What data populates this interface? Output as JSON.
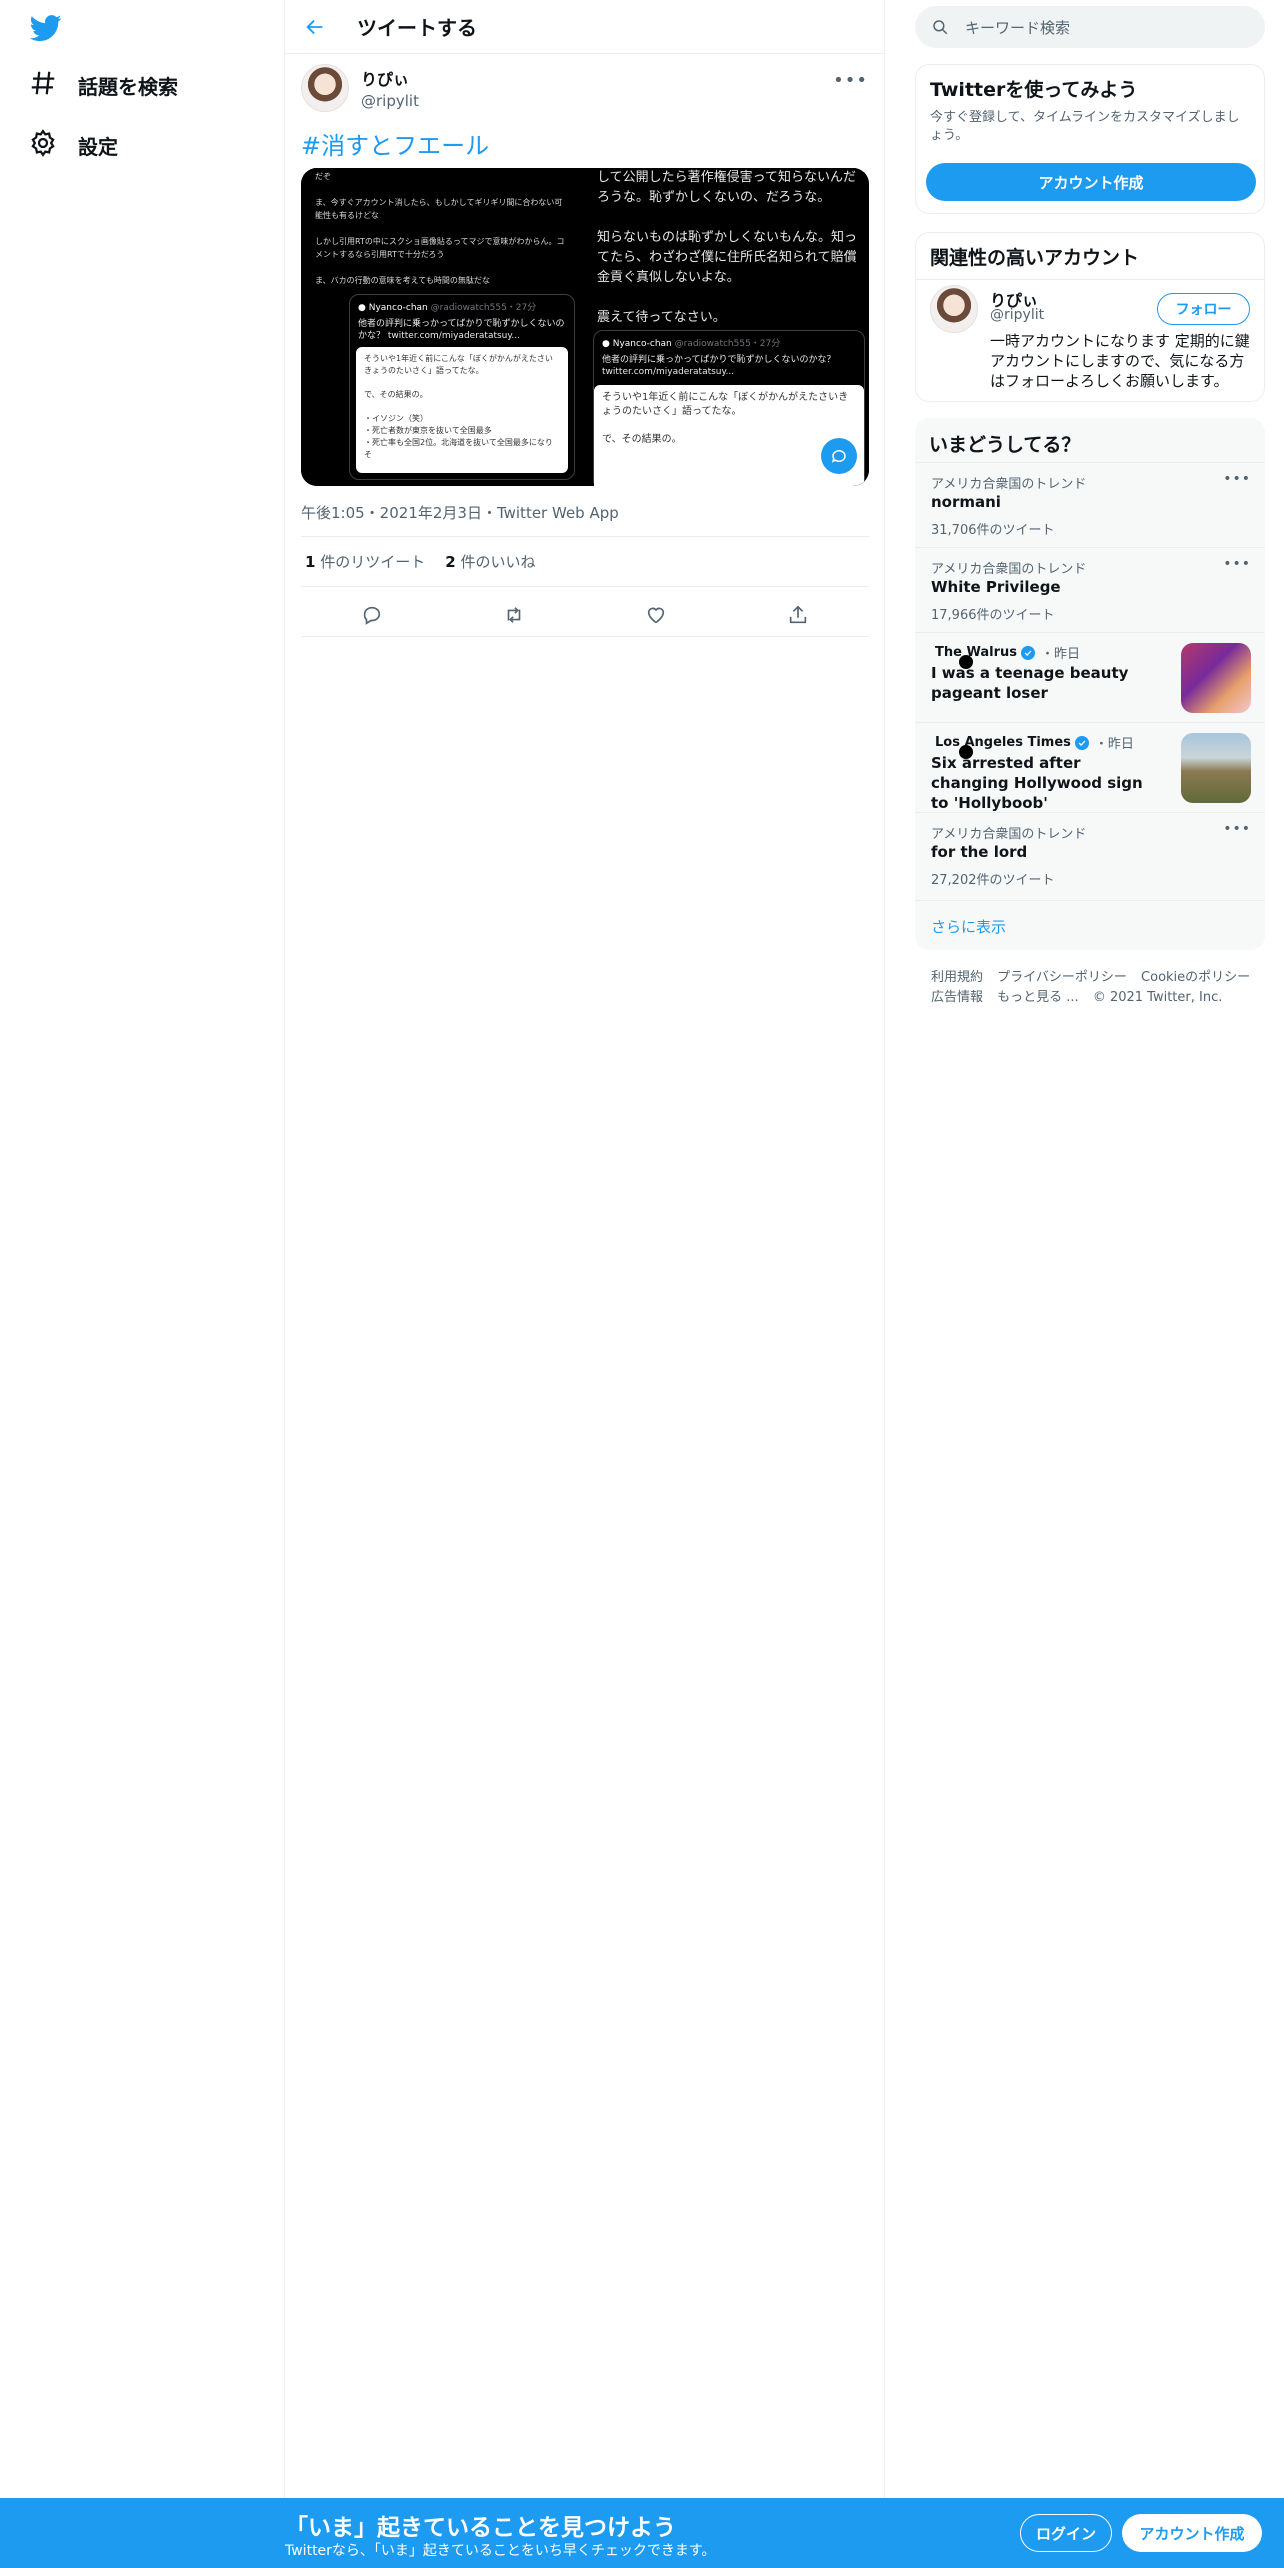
{
  "nav": {
    "explore_label": "話題を検索",
    "settings_label": "設定"
  },
  "header": {
    "title": "ツイートする"
  },
  "tweet": {
    "display_name": "りぴぃ",
    "handle": "@ripylit",
    "hashtag": "#消すとフエール",
    "timestamp": "午後1:05・2021年2月3日・Twitter Web App",
    "retweets_count": "1",
    "retweets_label": "件のリツイート",
    "likes_count": "2",
    "likes_label": "件のいいね",
    "media": {
      "left": {
        "top_text": "だぞ\n\nま、今すぐアカウント消したら、もしかしてギリギリ間に合わない可能性も有るけどな\n\nしかし引用RTの中にスクショ画像貼るってマジで意味がわからん。コメントするなら引用RTで十分だろう\n\nま、バカの行動の意味を考えても時間の無駄だな",
        "quote_name": "Nyanco-chan",
        "quote_handle": "@radiowatch555・27分",
        "quote_text": "他者の評判に乗っかってばかりで恥ずかしくないのかな？ twitter.com/miyaderatatsuy...",
        "inner_text": "そういや1年近く前にこんな「ぼくがかんがえたさいきょうのたいさく」語ってたな。\n\nで、その結果の。\n\n・イソジン（笑）\n・死亡者数が東京を抜いて全国最多\n・死亡率も全国2位。北海道を抜いて全国最多になりそ"
      },
      "right": {
        "top_text": "して公開したら著作権侵害って知らないんだろうな。恥ずかしくないの、だろうな。\n\n知らないものは恥ずかしくないもんな。知ってたら、わざわざ僕に住所氏名知られて賠償金貢ぐ真似しないよな。\n\n震えて待ってなさい。",
        "quote_name": "Nyanco-chan",
        "quote_handle": "@radiowatch555・27分",
        "quote_text": "他者の評判に乗っかってばかりで恥ずかしくないのかな？ twitter.com/miyaderatatsuy...",
        "inner_text": "そういや1年近く前にこんな「ぼくがかんがえたさいきょうのたいさく」語ってたな。\n\nで、その結果の。"
      }
    }
  },
  "search": {
    "placeholder": "キーワード検索"
  },
  "signup_panel": {
    "title": "Twitterを使ってみよう",
    "text": "今すぐ登録して、タイムラインをカスタマイズしましょう。",
    "button": "アカウント作成"
  },
  "related": {
    "title": "関連性の高いアカウント",
    "display_name": "りぴぃ",
    "handle": "@ripylit",
    "follow_label": "フォロー",
    "bio": "一時アカウントになります 定期的に鍵アカウントにしますので、気になる方はフォローよろしくお願いします。"
  },
  "trends": {
    "title": "いまどうしてる？",
    "items": [
      {
        "category": "アメリカ合衆国のトレンド",
        "name": "normani",
        "count": "31,706件のツイート"
      },
      {
        "category": "アメリカ合衆国のトレンド",
        "name": "White Privilege",
        "count": "17,966件のツイート"
      },
      {
        "source": "The Walrus",
        "when": "・昨日",
        "headline": "I was a teenage beauty pageant loser"
      },
      {
        "source": "Los Angeles Times",
        "when": "・昨日",
        "headline": "Six arrested after changing Hollywood sign to 'Hollyboob'"
      },
      {
        "category": "アメリカ合衆国のトレンド",
        "name": "for the lord",
        "count": "27,202件のツイート"
      }
    ],
    "show_more": "さらに表示"
  },
  "footer": {
    "links": [
      "利用規約",
      "プライバシーポリシー",
      "Cookieのポリシー",
      "広告情報",
      "もっと見る ..."
    ],
    "copyright": "© 2021 Twitter, Inc."
  },
  "bottom_bar": {
    "headline": "「いま」起きていることを見つけよう",
    "subtext": "Twitterなら、「いま」起きていることをいち早くチェックできます。",
    "login_label": "ログイン",
    "signup_label": "アカウント作成"
  },
  "colors": {
    "accent": "#1d9bf0",
    "text": "#0f1419",
    "muted": "#536471",
    "border": "#ebeef0"
  }
}
